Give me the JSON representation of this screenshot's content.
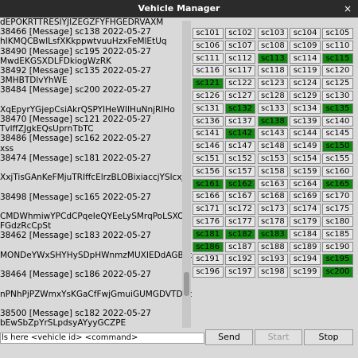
{
  "window": {
    "title": "Vehicle Manager",
    "close_glyph": "×"
  },
  "log": {
    "lines": [
      "dEPOKRTTRESIYJIZEGZFYFHGEDRVAXM",
      "38466 [Message] sc138 2022-05-27",
      "hIKMQCBwILsfXKkppwtvuuHzxFeMlEtUq",
      "38490 [Message] sc195 2022-05-27",
      "MwdEKGSXDLFDkiogWzRK",
      "38492 [Message] sc135 2022-05-27",
      "3MHBTDlvYhWE",
      "38484 [Message] sc200 2022-05-27",
      "",
      "XqEpyrYGjepCsiAkrQSPYIHeWIIHuNnjRIHo",
      "38470 [Message] sc121 2022-05-27",
      "TvlffZJgkEQsUprnTbTC",
      "38486 [Message] sc162 2022-05-27",
      "xss",
      "38474 [Message] sc181 2022-05-27",
      "",
      "XxjTisGAnKeFMjuTRIffcElrzBLOBixiaccjYSlcxJV",
      "",
      "38498 [Message] sc165 2022-05-27",
      "",
      "CMDWhmiwYPCdCPqeIeQYEeLySMrqPoLSXOQ",
      "FGdzRcCpSt",
      "38462 [Message] sc183 2022-05-27",
      "",
      "MONDeYWxSHYHySDpHWnmzMUXIEDdAGBdp",
      "",
      "38464 [Message] sc186 2022-05-27",
      "",
      "nPNhPjPZWmxYsKGaCfFwjGmuiGUMGDVTDuco",
      "",
      "38500 [Message] sc182 2022-05-27",
      "bEwSbZpYrSLpdsyAYyyGCZPE"
    ]
  },
  "vehicles": [
    {
      "id": "sc101",
      "active": false
    },
    {
      "id": "sc102",
      "active": false
    },
    {
      "id": "sc103",
      "active": false
    },
    {
      "id": "sc104",
      "active": false
    },
    {
      "id": "sc105",
      "active": false
    },
    {
      "id": "sc106",
      "active": false
    },
    {
      "id": "sc107",
      "active": false
    },
    {
      "id": "sc108",
      "active": false
    },
    {
      "id": "sc109",
      "active": false
    },
    {
      "id": "sc110",
      "active": false
    },
    {
      "id": "sc111",
      "active": false
    },
    {
      "id": "sc112",
      "active": false
    },
    {
      "id": "sc113",
      "active": true
    },
    {
      "id": "sc114",
      "active": false
    },
    {
      "id": "sc115",
      "active": true
    },
    {
      "id": "sc116",
      "active": false
    },
    {
      "id": "sc117",
      "active": false
    },
    {
      "id": "sc118",
      "active": false
    },
    {
      "id": "sc119",
      "active": false
    },
    {
      "id": "sc120",
      "active": false
    },
    {
      "id": "sc121",
      "active": true
    },
    {
      "id": "sc122",
      "active": false
    },
    {
      "id": "sc123",
      "active": false
    },
    {
      "id": "sc124",
      "active": false
    },
    {
      "id": "sc125",
      "active": false
    },
    {
      "id": "sc126",
      "active": false
    },
    {
      "id": "sc127",
      "active": false
    },
    {
      "id": "sc128",
      "active": false
    },
    {
      "id": "sc129",
      "active": false
    },
    {
      "id": "sc130",
      "active": false
    },
    {
      "id": "sc131",
      "active": false
    },
    {
      "id": "sc132",
      "active": true
    },
    {
      "id": "sc133",
      "active": false
    },
    {
      "id": "sc134",
      "active": false
    },
    {
      "id": "sc135",
      "active": true
    },
    {
      "id": "sc136",
      "active": false
    },
    {
      "id": "sc137",
      "active": false
    },
    {
      "id": "sc138",
      "active": true
    },
    {
      "id": "sc139",
      "active": false
    },
    {
      "id": "sc140",
      "active": false
    },
    {
      "id": "sc141",
      "active": false
    },
    {
      "id": "sc142",
      "active": true
    },
    {
      "id": "sc143",
      "active": false
    },
    {
      "id": "sc144",
      "active": false
    },
    {
      "id": "sc145",
      "active": false
    },
    {
      "id": "sc146",
      "active": false
    },
    {
      "id": "sc147",
      "active": false
    },
    {
      "id": "sc148",
      "active": false
    },
    {
      "id": "sc149",
      "active": false
    },
    {
      "id": "sc150",
      "active": true
    },
    {
      "id": "sc151",
      "active": false
    },
    {
      "id": "sc152",
      "active": false
    },
    {
      "id": "sc153",
      "active": false
    },
    {
      "id": "sc154",
      "active": false
    },
    {
      "id": "sc155",
      "active": false
    },
    {
      "id": "sc156",
      "active": false
    },
    {
      "id": "sc157",
      "active": false
    },
    {
      "id": "sc158",
      "active": false
    },
    {
      "id": "sc159",
      "active": false
    },
    {
      "id": "sc160",
      "active": false
    },
    {
      "id": "sc161",
      "active": true
    },
    {
      "id": "sc162",
      "active": true
    },
    {
      "id": "sc163",
      "active": false
    },
    {
      "id": "sc164",
      "active": false
    },
    {
      "id": "sc165",
      "active": true
    },
    {
      "id": "sc166",
      "active": false
    },
    {
      "id": "sc167",
      "active": false
    },
    {
      "id": "sc168",
      "active": false
    },
    {
      "id": "sc169",
      "active": false
    },
    {
      "id": "sc170",
      "active": false
    },
    {
      "id": "sc171",
      "active": false
    },
    {
      "id": "sc172",
      "active": false
    },
    {
      "id": "sc173",
      "active": false
    },
    {
      "id": "sc174",
      "active": false
    },
    {
      "id": "sc175",
      "active": false
    },
    {
      "id": "sc176",
      "active": false
    },
    {
      "id": "sc177",
      "active": false
    },
    {
      "id": "sc178",
      "active": false
    },
    {
      "id": "sc179",
      "active": false
    },
    {
      "id": "sc180",
      "active": false
    },
    {
      "id": "sc181",
      "active": true
    },
    {
      "id": "sc182",
      "active": true
    },
    {
      "id": "sc183",
      "active": true
    },
    {
      "id": "sc184",
      "active": false
    },
    {
      "id": "sc185",
      "active": false
    },
    {
      "id": "sc186",
      "active": true
    },
    {
      "id": "sc187",
      "active": false
    },
    {
      "id": "sc188",
      "active": false
    },
    {
      "id": "sc189",
      "active": false
    },
    {
      "id": "sc190",
      "active": false
    },
    {
      "id": "sc191",
      "active": false
    },
    {
      "id": "sc192",
      "active": false
    },
    {
      "id": "sc193",
      "active": false
    },
    {
      "id": "sc194",
      "active": false
    },
    {
      "id": "sc195",
      "active": true
    },
    {
      "id": "sc196",
      "active": false
    },
    {
      "id": "sc197",
      "active": false
    },
    {
      "id": "sc198",
      "active": false
    },
    {
      "id": "sc199",
      "active": false
    },
    {
      "id": "sc200",
      "active": true
    }
  ],
  "command": {
    "value": "ls here <vehicle id> <command>"
  },
  "buttons": {
    "send": "Send",
    "start": "Start",
    "stop": "Stop"
  },
  "colors": {
    "active_vehicle": "#128a12",
    "titlebar": "#2b2b2b"
  }
}
